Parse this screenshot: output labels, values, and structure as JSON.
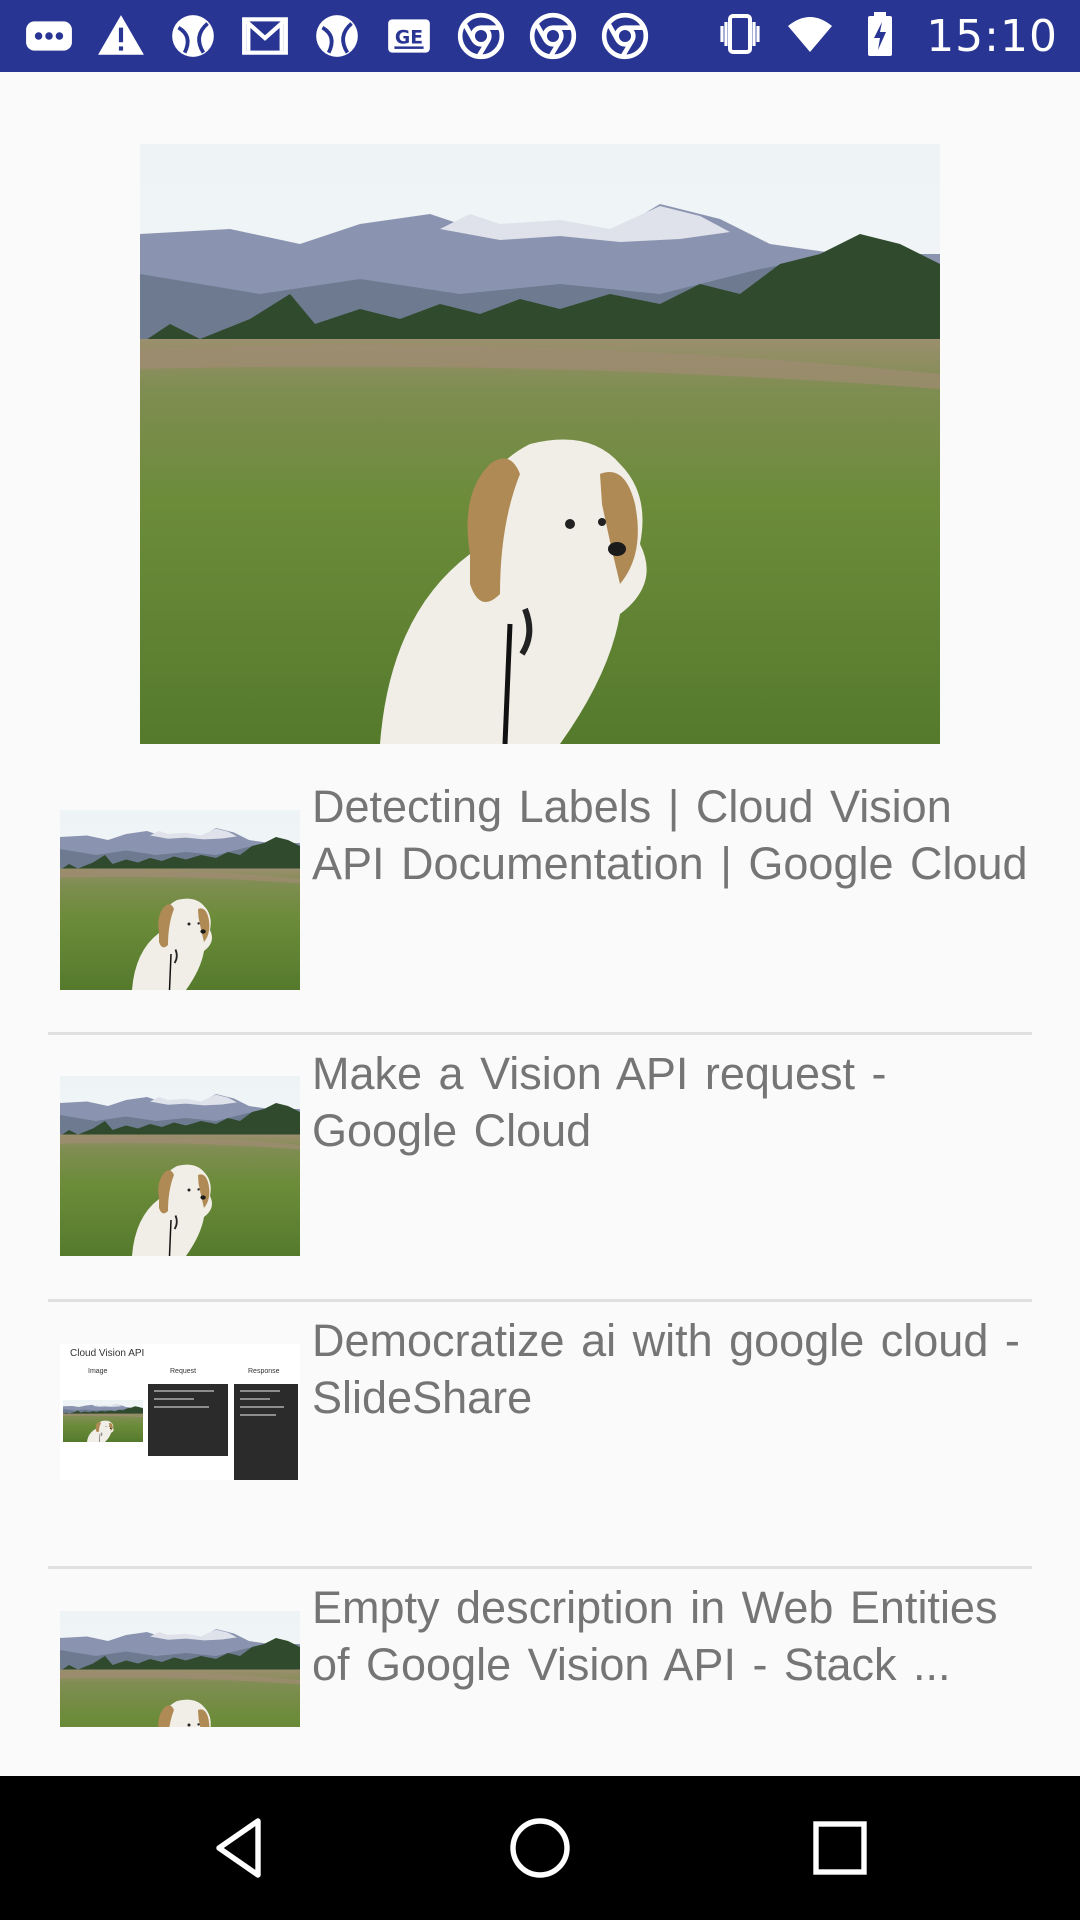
{
  "status_bar": {
    "time": "15:10",
    "notification_icons": [
      "more-dots-icon",
      "warning-icon",
      "ball-icon",
      "gmail-icon",
      "ball-icon",
      "ge-icon",
      "chrome-icon",
      "chrome-icon",
      "chrome-icon"
    ],
    "system_icons": [
      "vibrate-icon",
      "wifi-icon",
      "battery-charging-icon"
    ]
  },
  "hero_image": {
    "description": "dog-in-meadow"
  },
  "results": [
    {
      "title": "Detecting  Labels  | Cloud  Vision  API  Documentation |  Google  Cloud",
      "thumbnail": "dog-photo"
    },
    {
      "title": "Make a  Vision API  request - Google Cloud",
      "thumbnail": "dog-photo"
    },
    {
      "title": "Democratize ai with  google cloud - SlideShare",
      "thumbnail": "cloud-vision-slide",
      "slide": {
        "heading": "Cloud Vision API",
        "col_image": "Image",
        "col_request": "Request",
        "col_response": "Response"
      }
    },
    {
      "title": "Empty description in Web Entities of  Google Vision API  - Stack ...",
      "thumbnail": "dog-photo"
    }
  ],
  "nav_bar": {
    "back": "back-icon",
    "home": "home-icon",
    "recents": "recents-icon"
  }
}
